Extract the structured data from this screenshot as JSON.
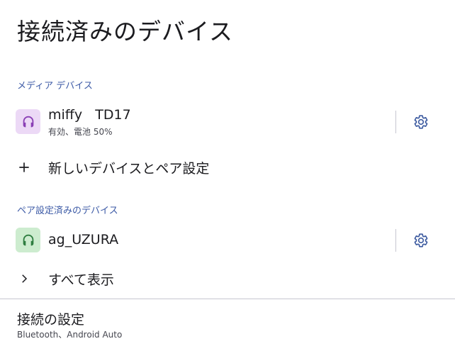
{
  "page": {
    "title": "接続済みのデバイス"
  },
  "media_section": {
    "header": "メディア デバイス",
    "device": {
      "name": "miffy   TD17",
      "status": "有効、電池 50%",
      "icon": "headset-icon",
      "icon_bg": "#ecd9f6",
      "icon_color": "#8a3fb5"
    },
    "settings_icon": "gear-icon"
  },
  "pair_new": {
    "label": "新しいデバイスとペア設定",
    "icon": "plus-icon"
  },
  "paired_section": {
    "header": "ペア設定済みのデバイス",
    "device": {
      "name": "ag_UZURA",
      "icon": "headset-icon",
      "icon_bg": "#cdeccf",
      "icon_color": "#2e7d40"
    },
    "settings_icon": "gear-icon"
  },
  "show_all": {
    "label": "すべて表示",
    "icon": "chevron-right-icon"
  },
  "connection_settings": {
    "title": "接続の設定",
    "subtitle": "Bluetooth、Android Auto"
  },
  "colors": {
    "accent": "#3c5aa6",
    "gear": "#3d5ba0"
  }
}
